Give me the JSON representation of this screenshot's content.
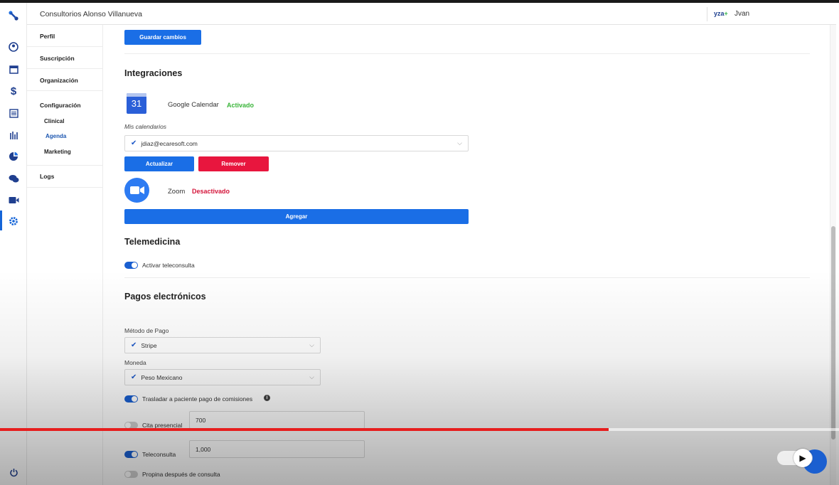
{
  "header": {
    "app_title": "Consultorios Alonso Villanueva",
    "logo_text": "yza",
    "logo_plus": "+",
    "user_name": "Jvan"
  },
  "rail": {
    "icons": [
      "app-logo-icon",
      "profile-icon",
      "calendar-icon",
      "dollar-icon",
      "list-icon",
      "chart-icon",
      "analytics-icon",
      "chat-icon",
      "video-icon",
      "settings-icon",
      "power-icon"
    ],
    "active_icon": "settings-icon"
  },
  "subnav": {
    "perfil": "Perfil",
    "suscripcion": "Suscripción",
    "organizacion": "Organización",
    "configuracion": "Configuración",
    "clinical": "Clinical",
    "agenda": "Agenda",
    "marketing": "Marketing",
    "logs": "Logs"
  },
  "main": {
    "save_button": "Guardar cambios",
    "integraciones_title": "Integraciones",
    "google": {
      "icon_day": "31",
      "name": "Google Calendar",
      "status": "Activado",
      "calendars_label": "Mis calendarios",
      "calendar_selected": "jdiaz@ecaresoft.com",
      "update_button": "Actualizar",
      "remove_button": "Remover"
    },
    "zoom": {
      "name": "Zoom",
      "status": "Desactivado",
      "add_button": "Agregar"
    },
    "telemedicina_title": "Telemedicina",
    "teleconsulta_toggle_label": "Activar teleconsulta",
    "pagos_title": "Pagos electrónicos",
    "metodo_label": "Método de Pago",
    "metodo_value": "Stripe",
    "moneda_label": "Moneda",
    "moneda_value": "Peso Mexicano",
    "comisiones_label": "Trasladar a paciente pago de comisiones",
    "cita_label": "Cita presencial",
    "cita_value": "700",
    "teleconsulta_label": "Teleconsulta",
    "teleconsulta_value": "1,000",
    "propina_label": "Propina después de consulta"
  },
  "video": {
    "progress_percent": 72.5
  },
  "colors": {
    "primary": "#1a6ee6",
    "danger": "#e8163e",
    "success": "#3ab53a",
    "nav_active": "#1c56b0"
  }
}
